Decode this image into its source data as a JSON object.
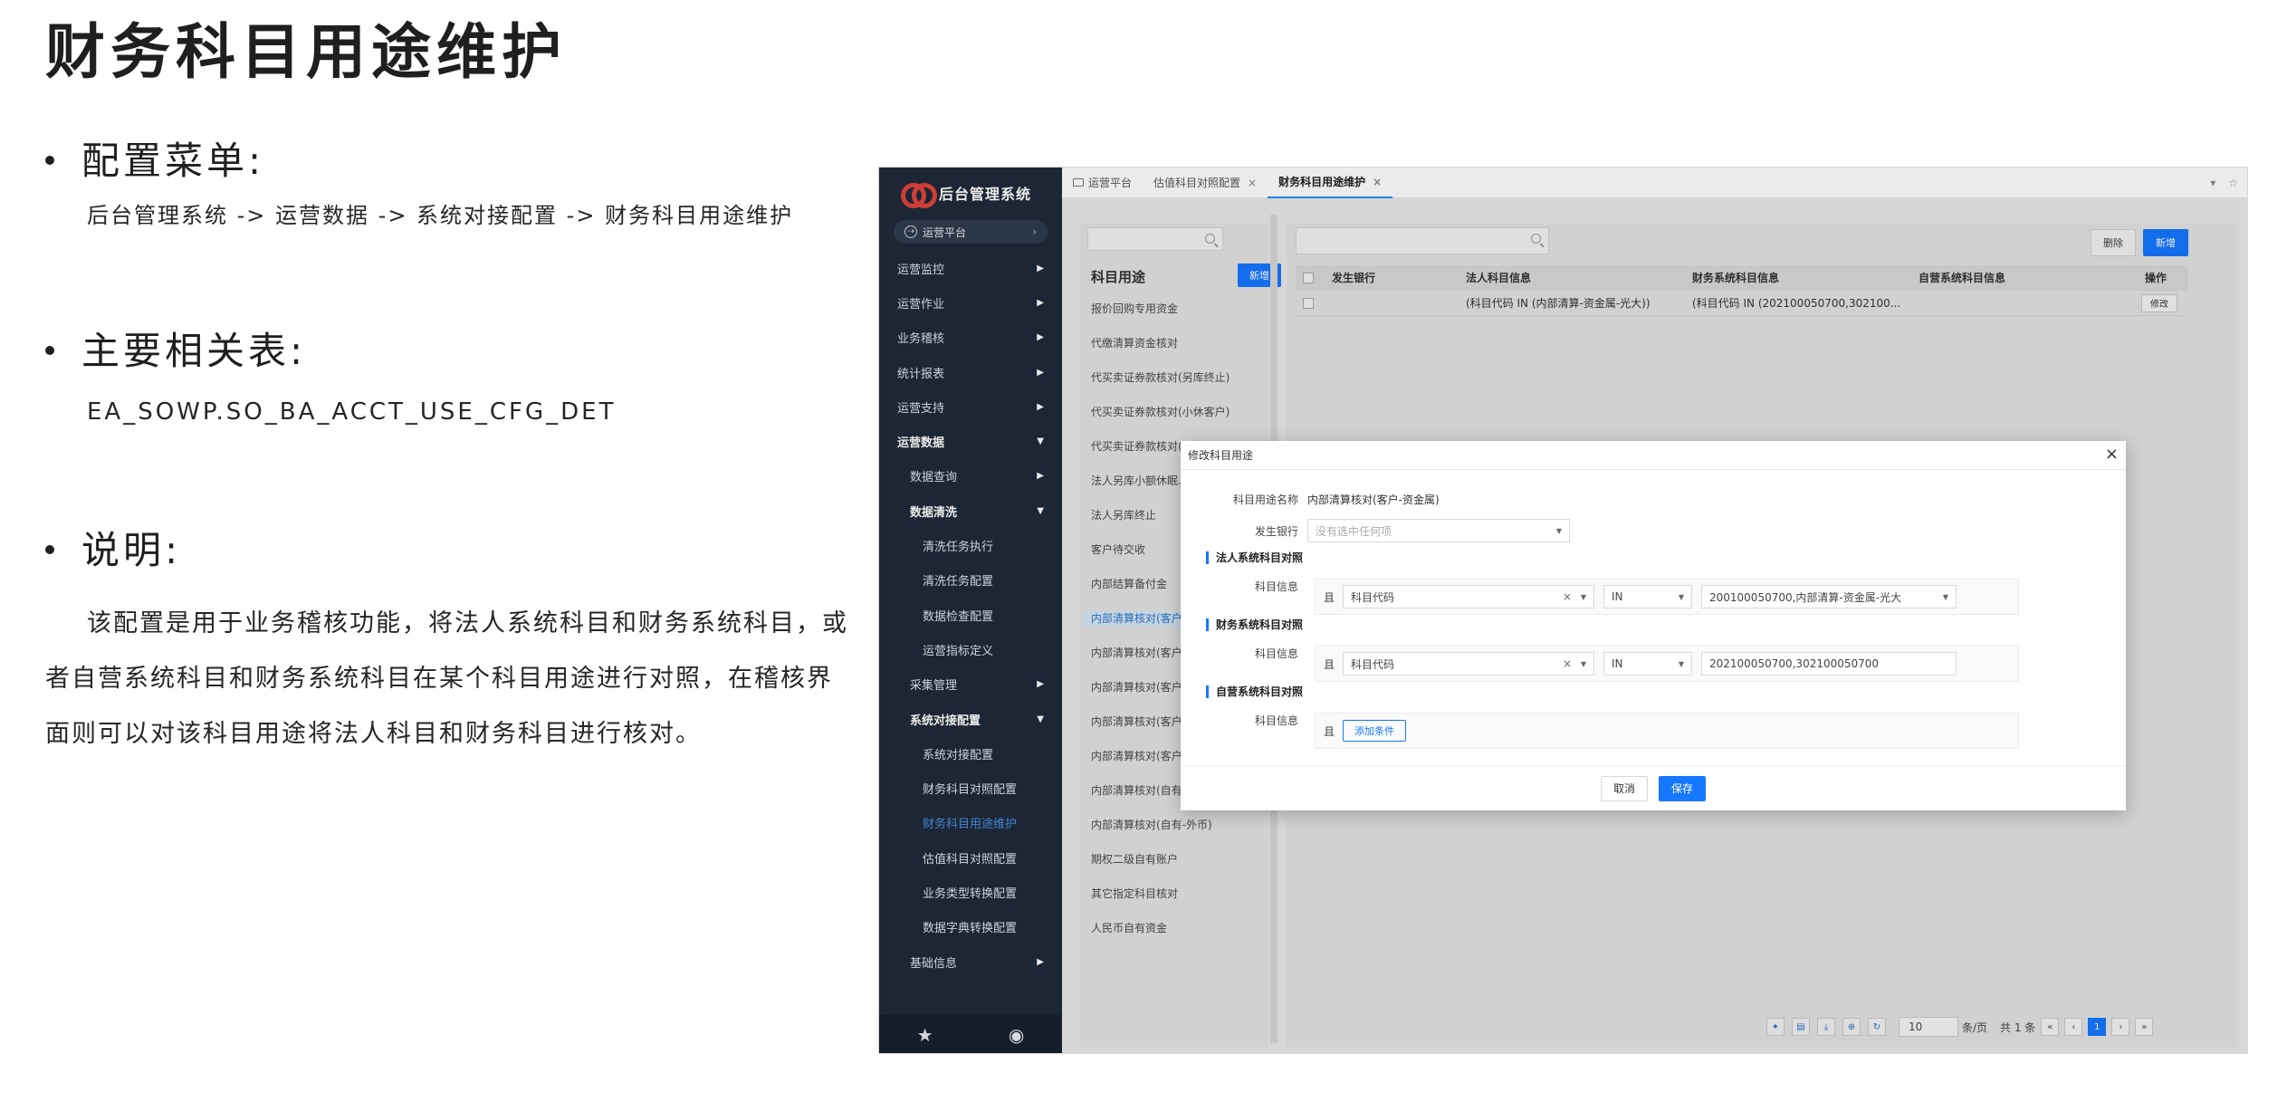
{
  "slide": {
    "title": "财务科目用途维护",
    "menu_heading": "配置菜单:",
    "menu_path": "后台管理系统 -> 运营数据 -> 系统对接配置 -> 财务科目用途维护",
    "table_heading": "主要相关表:",
    "table_name": "EA_SOWP.SO_BA_ACCT_USE_CFG_DET",
    "desc_heading": "说明:",
    "description": "该配置是用于业务稽核功能，将法人系统科目和财务系统科目，或者自营系统科目和财务系统科目在某个科目用途进行对照，在稽核界面则可以对该科目用途将法人科目和财务科目进行核对。"
  },
  "app": {
    "name": "后台管理系统",
    "platform": "运营平台",
    "menu": [
      {
        "label": "运营监控",
        "level": 1,
        "expanded": false
      },
      {
        "label": "运营作业",
        "level": 1,
        "expanded": false
      },
      {
        "label": "业务稽核",
        "level": 1,
        "expanded": false
      },
      {
        "label": "统计报表",
        "level": 1,
        "expanded": false
      },
      {
        "label": "运营支持",
        "level": 1,
        "expanded": false
      },
      {
        "label": "运营数据",
        "level": 1,
        "expanded": true
      },
      {
        "label": "数据查询",
        "level": 2,
        "expanded": false
      },
      {
        "label": "数据清洗",
        "level": 2,
        "expanded": true
      },
      {
        "label": "清洗任务执行",
        "level": 3
      },
      {
        "label": "清洗任务配置",
        "level": 3
      },
      {
        "label": "数据检查配置",
        "level": 3
      },
      {
        "label": "运营指标定义",
        "level": 3
      },
      {
        "label": "采集管理",
        "level": 2,
        "expanded": false
      },
      {
        "label": "系统对接配置",
        "level": 2,
        "expanded": true
      },
      {
        "label": "系统对接配置",
        "level": 3
      },
      {
        "label": "财务科目对照配置",
        "level": 3
      },
      {
        "label": "财务科目用途维护",
        "level": 3,
        "active": true
      },
      {
        "label": "估值科目对照配置",
        "level": 3
      },
      {
        "label": "业务类型转换配置",
        "level": 3
      },
      {
        "label": "数据字典转换配置",
        "level": 3
      },
      {
        "label": "基础信息",
        "level": 2,
        "expanded": false
      }
    ],
    "tabs": [
      {
        "label": "运营平台",
        "closable": false,
        "active": false
      },
      {
        "label": "估值科目对照配置",
        "closable": true,
        "active": false
      },
      {
        "label": "财务科目用途维护",
        "closable": true,
        "active": true
      }
    ],
    "left_panel": {
      "title": "科目用途",
      "add_label": "新增",
      "items": [
        "报价回购专用资金",
        "代缴清算资金核对",
        "代买卖证券款核对(另库终止)",
        "代买卖证券款核对(小休客户)",
        "代买卖证券款核对(...户)",
        "法人另库小额休眠...",
        "法人另库终止",
        "客户待交收",
        "内部结算备付金",
        "内部清算核对(客户-资金属)",
        "内部清算核对(客户...)",
        "内部清算核对(客户...)",
        "内部清算核对(客户...)",
        "内部清算核对(客户-衍生品)",
        "内部清算核对(自有-人民币)",
        "内部清算核对(自有-外币)",
        "期权二级自有账户",
        "其它指定科目核对",
        "人民币自有资金"
      ],
      "selected_index": 9
    },
    "right_panel": {
      "delete_label": "删除",
      "add_label": "新增",
      "columns": [
        "发生银行",
        "法人科目信息",
        "财务系统科目信息",
        "自营系统科目信息",
        "操作"
      ],
      "rows": [
        {
          "bank": "",
          "legal": "(科目代码 IN (内部清算-资金属-光大))",
          "finance": "(科目代码 IN (202100050700,302100...",
          "self": "",
          "action": "修改"
        }
      ],
      "pager": {
        "page_size": "10",
        "per_page_label": "条/页",
        "total": "共 1 条",
        "current_page": "1"
      }
    },
    "modal": {
      "title": "修改科目用途",
      "name_label": "科目用途名称",
      "name_value": "内部清算核对(客户-资金属)",
      "bank_label": "发生银行",
      "bank_placeholder": "没有选中任何项",
      "sections": [
        {
          "heading": "法人系统科目对照",
          "field_label": "科目信息",
          "and_label": "且",
          "field": "科目代码",
          "op": "IN",
          "value": "200100050700,内部清算-资金属-光大",
          "value_is_select": true
        },
        {
          "heading": "财务系统科目对照",
          "field_label": "科目信息",
          "and_label": "且",
          "field": "科目代码",
          "op": "IN",
          "value": "202100050700,302100050700",
          "value_is_select": false
        },
        {
          "heading": "自营系统科目对照",
          "field_label": "科目信息",
          "and_label": "且",
          "add_condition": "添加条件"
        }
      ],
      "cancel_label": "取消",
      "save_label": "保存"
    }
  }
}
